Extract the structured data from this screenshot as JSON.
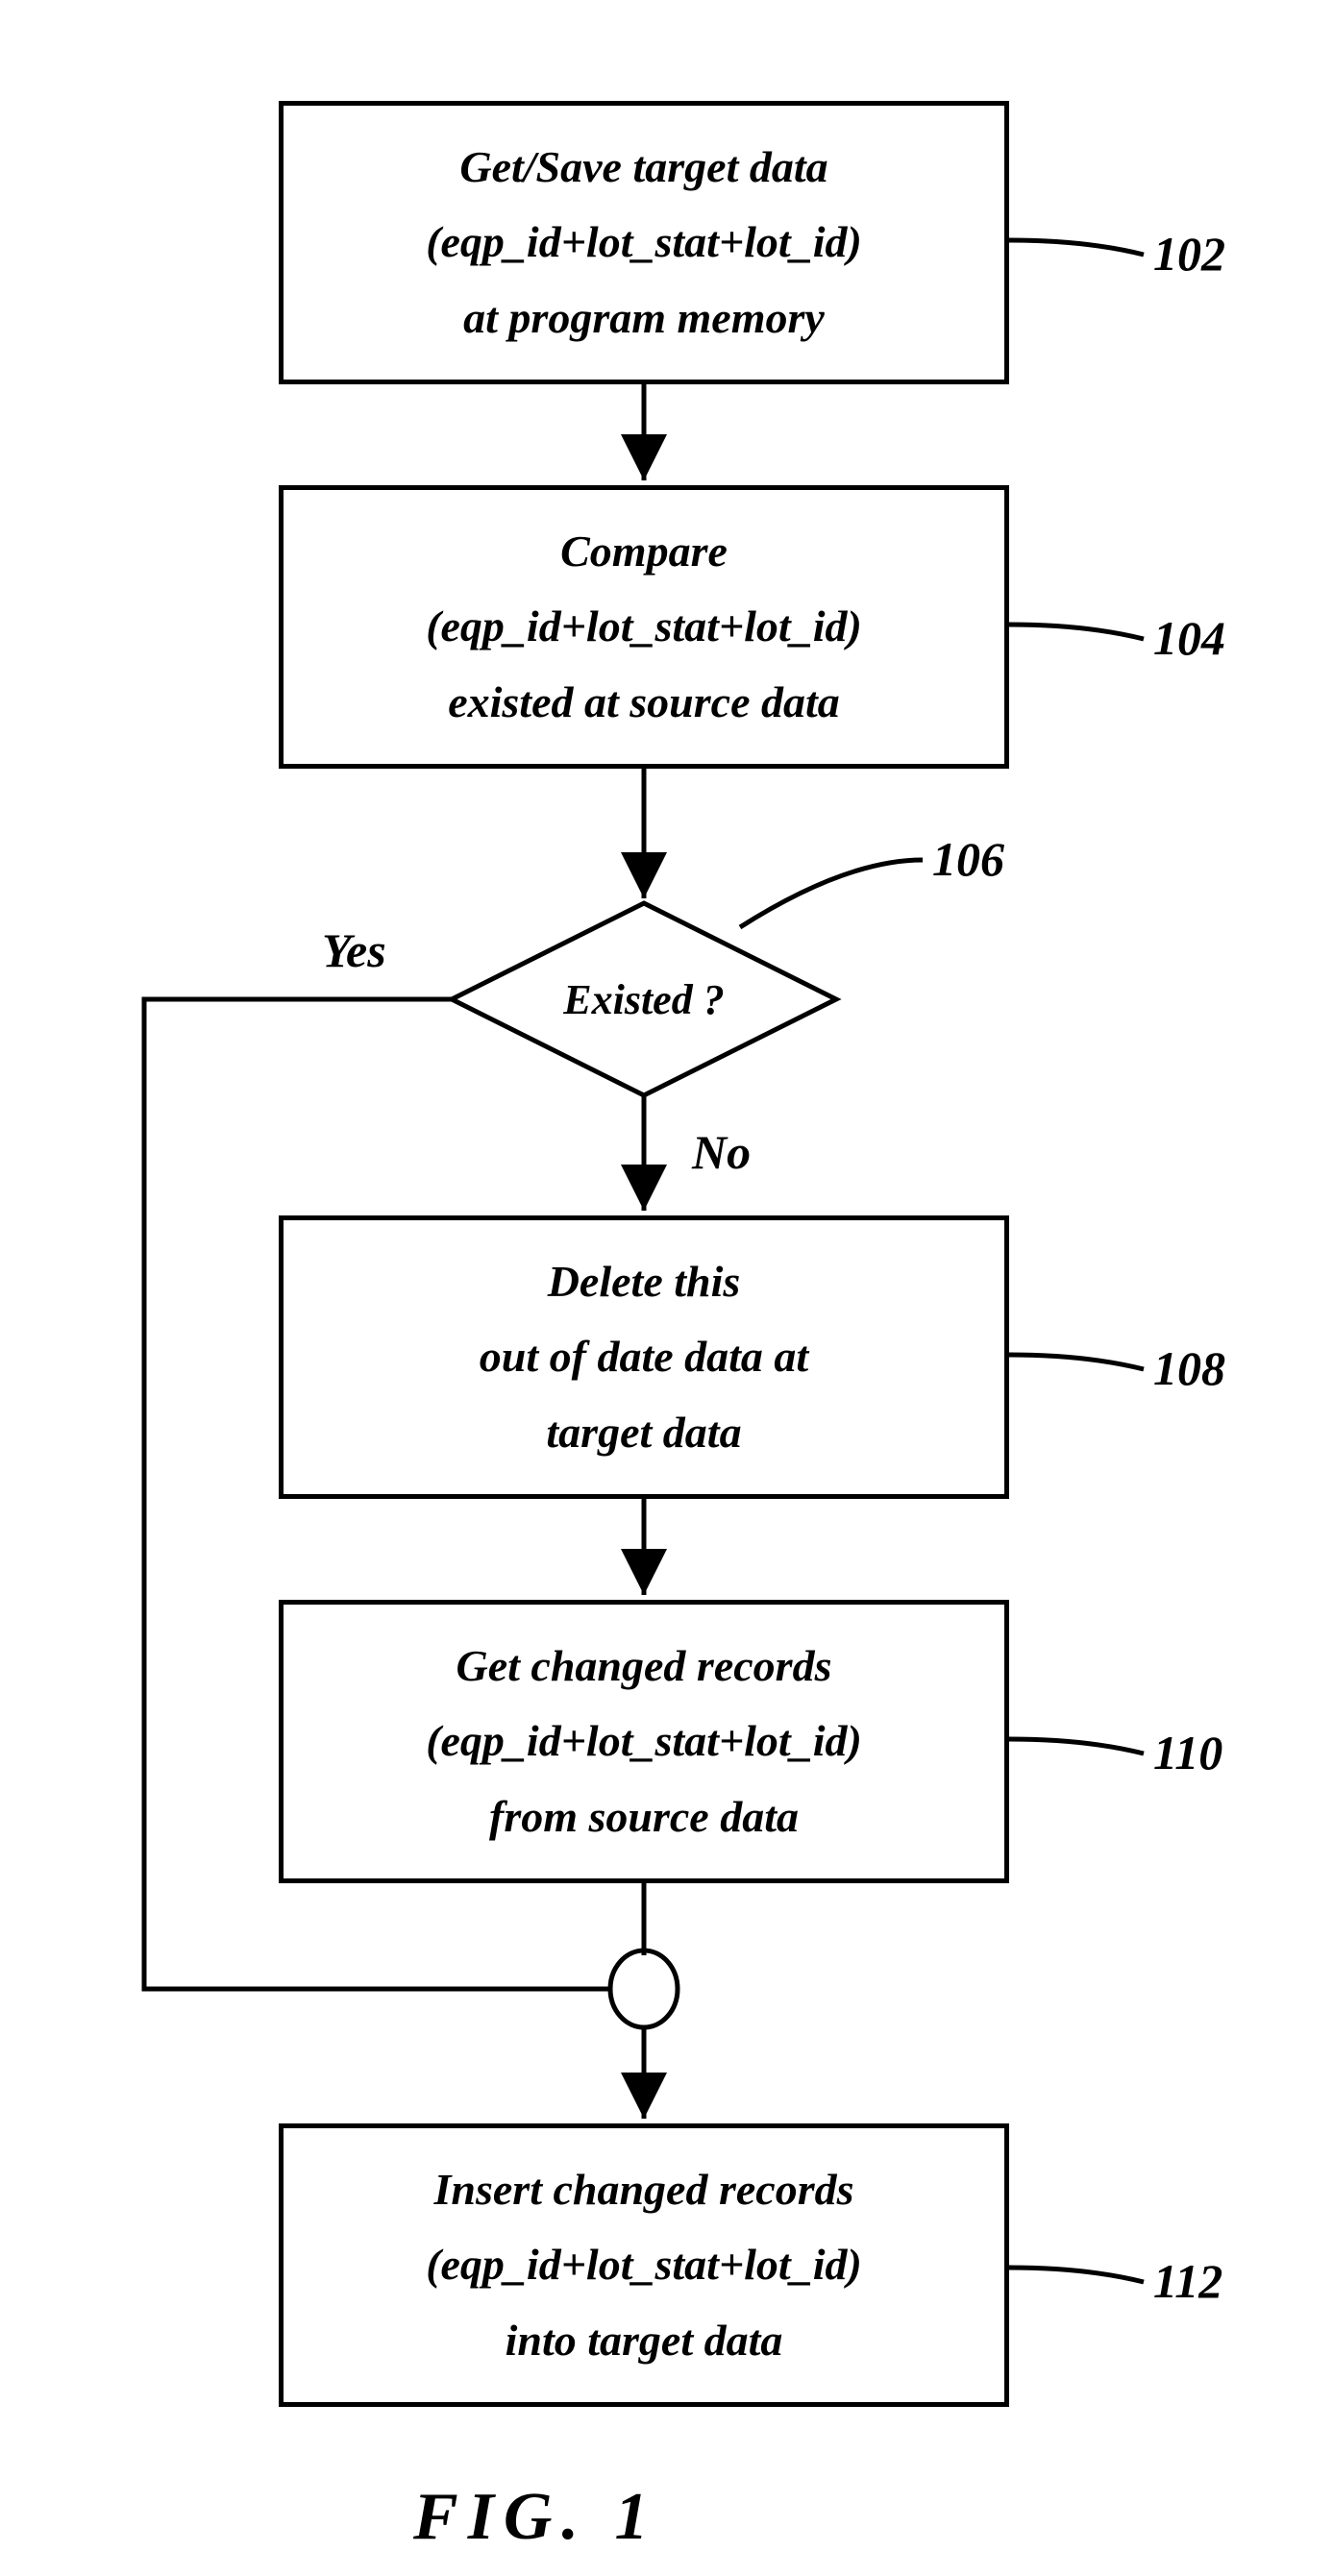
{
  "nodes": {
    "n102": {
      "line1": "Get/Save target data",
      "line2": "(eqp_id+lot_stat+lot_id)",
      "line3": "at program memory",
      "ref": "102"
    },
    "n104": {
      "line1": "Compare",
      "line2": "(eqp_id+lot_stat+lot_id)",
      "line3": "existed at source data",
      "ref": "104"
    },
    "n106": {
      "label": "Existed ?",
      "ref": "106"
    },
    "n108": {
      "line1": "Delete this",
      "line2": "out of date data at",
      "line3": "target data",
      "ref": "108"
    },
    "n110": {
      "line1": "Get changed records",
      "line2": "(eqp_id+lot_stat+lot_id)",
      "line3": "from source data",
      "ref": "110"
    },
    "n112": {
      "line1": "Insert changed records",
      "line2": "(eqp_id+lot_stat+lot_id)",
      "line3": "into target data",
      "ref": "112"
    }
  },
  "edges": {
    "yes": "Yes",
    "no": "No"
  },
  "figure_caption": "FIG.  1"
}
